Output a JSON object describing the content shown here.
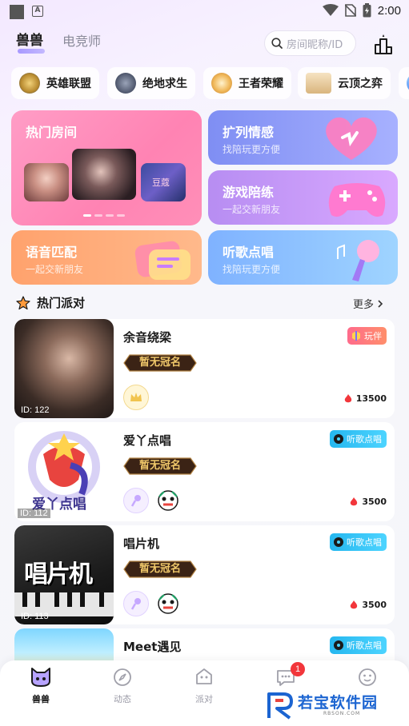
{
  "status_bar": {
    "time": "2:00"
  },
  "header": {
    "tabs": [
      "兽兽",
      "电竞师"
    ],
    "search_placeholder": "房间昵称/ID"
  },
  "games": [
    {
      "label": "英雄联盟"
    },
    {
      "label": "绝地求生"
    },
    {
      "label": "王者荣耀"
    },
    {
      "label": "云顶之弈"
    }
  ],
  "cards": {
    "hot_rooms": {
      "title": "热门房间"
    },
    "kuolie": {
      "title": "扩列情感",
      "subtitle": "找陪玩更方便"
    },
    "game_peilian": {
      "title": "游戏陪练",
      "subtitle": "一起交新朋友"
    },
    "voice_match": {
      "title": "语音匹配",
      "subtitle": "一起交新朋友"
    },
    "song_request": {
      "title": "听歌点唱",
      "subtitle": "找陪玩更方便"
    },
    "hot_room_thumb_label": "豆蔻"
  },
  "section": {
    "title": "热门派对",
    "more": "更多"
  },
  "rooms": [
    {
      "name": "余音绕梁",
      "id": "ID: 122",
      "crown": "暂无冠名",
      "tag": "玩伴",
      "heat": "13500"
    },
    {
      "name": "爱丫点唱",
      "id": "ID: 112",
      "crown": "暂无冠名",
      "tag": "听歌点唱",
      "heat": "3500",
      "cover_text": "爱丫点唱"
    },
    {
      "name": "唱片机",
      "id": "ID: 113",
      "crown": "暂无冠名",
      "tag": "听歌点唱",
      "heat": "3500",
      "cover_text": "唱片机"
    },
    {
      "name": "Meet遇见",
      "tag": "听歌点唱"
    }
  ],
  "nav": [
    {
      "label": "兽兽"
    },
    {
      "label": "动态"
    },
    {
      "label": "派对"
    },
    {
      "label": "消息",
      "badge": "1"
    },
    {
      "label": "我的"
    }
  ],
  "watermark": {
    "text": "若宝软件园",
    "sub": "RBSON.COM"
  }
}
